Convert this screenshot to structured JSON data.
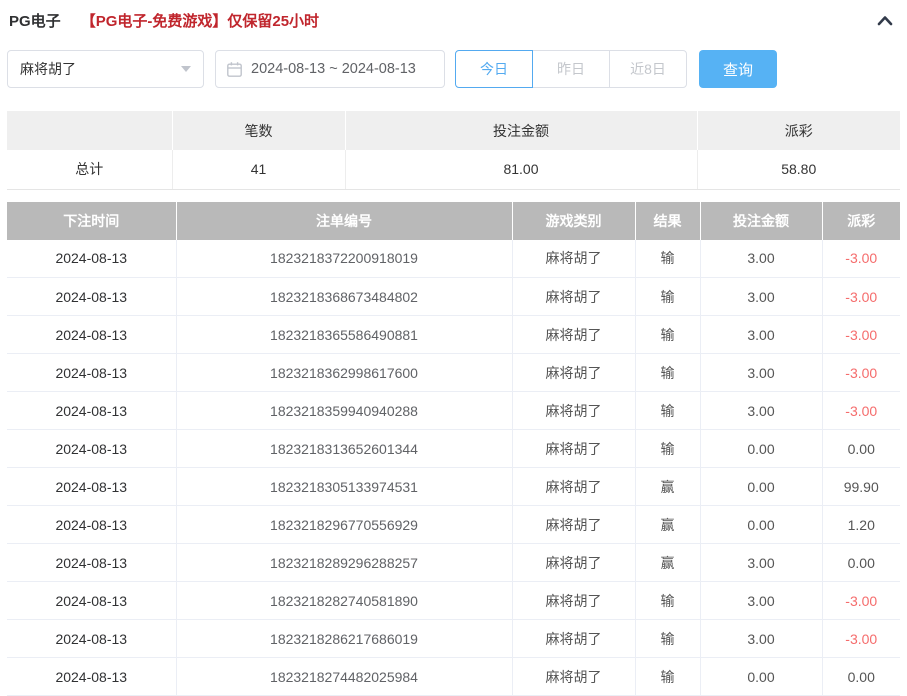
{
  "header": {
    "title": "PG电子",
    "notice": "【PG电子-免费游戏】仅保留25小时"
  },
  "filters": {
    "game_select_value": "麻将胡了",
    "date_range_value": "2024-08-13 ~ 2024-08-13",
    "quick_buttons": [
      {
        "label": "今日",
        "active": true
      },
      {
        "label": "昨日",
        "active": false
      },
      {
        "label": "近8日",
        "active": false
      }
    ],
    "query_label": "查询"
  },
  "summary": {
    "headers": [
      "",
      "笔数",
      "投注金额",
      "派彩"
    ],
    "row_label": "总计",
    "count": "41",
    "bet_total": "81.00",
    "payout_total": "58.80"
  },
  "table": {
    "headers": [
      "下注时间",
      "注单编号",
      "游戏类别",
      "结果",
      "投注金额",
      "派彩"
    ],
    "rows": [
      [
        "2024-08-13",
        "1823218372200918019",
        "麻将胡了",
        "输",
        "3.00",
        "-3.00"
      ],
      [
        "2024-08-13",
        "1823218368673484802",
        "麻将胡了",
        "输",
        "3.00",
        "-3.00"
      ],
      [
        "2024-08-13",
        "1823218365586490881",
        "麻将胡了",
        "输",
        "3.00",
        "-3.00"
      ],
      [
        "2024-08-13",
        "1823218362998617600",
        "麻将胡了",
        "输",
        "3.00",
        "-3.00"
      ],
      [
        "2024-08-13",
        "1823218359940940288",
        "麻将胡了",
        "输",
        "3.00",
        "-3.00"
      ],
      [
        "2024-08-13",
        "1823218313652601344",
        "麻将胡了",
        "输",
        "0.00",
        "0.00"
      ],
      [
        "2024-08-13",
        "1823218305133974531",
        "麻将胡了",
        "赢",
        "0.00",
        "99.90"
      ],
      [
        "2024-08-13",
        "1823218296770556929",
        "麻将胡了",
        "赢",
        "0.00",
        "1.20"
      ],
      [
        "2024-08-13",
        "1823218289296288257",
        "麻将胡了",
        "赢",
        "3.00",
        "0.00"
      ],
      [
        "2024-08-13",
        "1823218282740581890",
        "麻将胡了",
        "输",
        "3.00",
        "-3.00"
      ],
      [
        "2024-08-13",
        "1823218286217686019",
        "麻将胡了",
        "输",
        "3.00",
        "-3.00"
      ],
      [
        "2024-08-13",
        "1823218274482025984",
        "麻将胡了",
        "输",
        "0.00",
        "0.00"
      ]
    ]
  },
  "colors": {
    "accent_blue": "#56b2f4",
    "notice_red": "#c0262d",
    "negative_red": "#f56c6c",
    "table_header_bg": "#b9b9b9",
    "summary_header_bg": "#efefef"
  }
}
